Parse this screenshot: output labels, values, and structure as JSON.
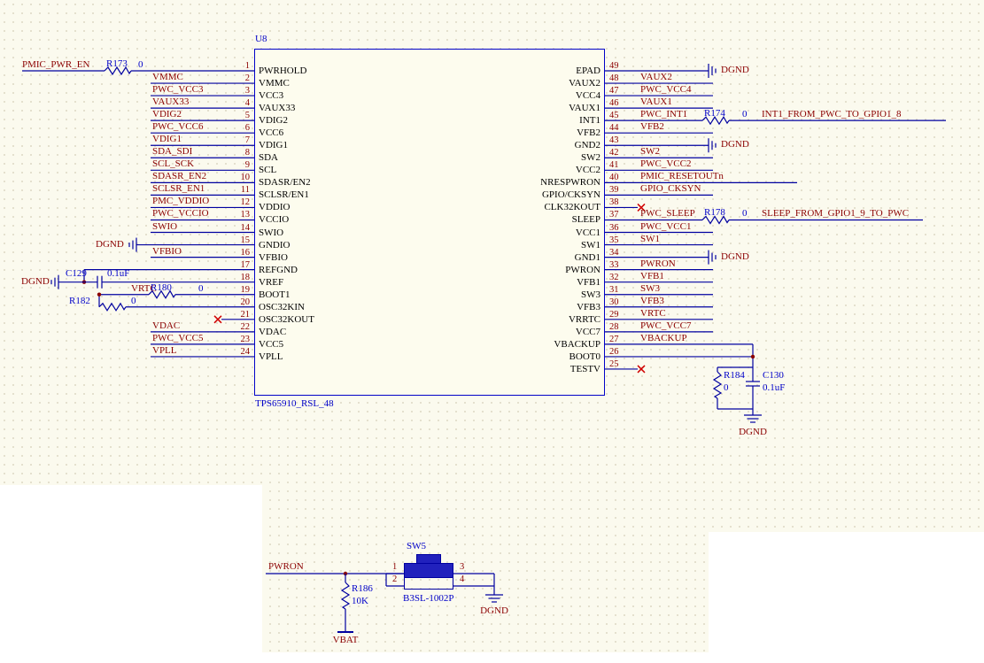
{
  "colors": {
    "wire": "#0000a0",
    "net_label": "#8b0000",
    "designator": "#0000c8",
    "pin_name": "#000000",
    "pin_number": "#8b0000",
    "no_connect": "#d00000",
    "switch_fill": "#2121bd"
  },
  "chip": {
    "designator": "U8",
    "comment": "TPS65910_RSL_48",
    "left_rows": [
      {
        "pin": "1",
        "pin_name": "PWRHOLD",
        "conn": "series",
        "net": "PMIC_PWR_EN",
        "ref": "R173",
        "value": "0"
      },
      {
        "pin": "2",
        "pin_name": "VMMC",
        "conn": "label",
        "net": "VMMC"
      },
      {
        "pin": "3",
        "pin_name": "VCC3",
        "conn": "label",
        "net": "PWC_VCC3"
      },
      {
        "pin": "4",
        "pin_name": "VAUX33",
        "conn": "label",
        "net": "VAUX33"
      },
      {
        "pin": "5",
        "pin_name": "VDIG2",
        "conn": "label",
        "net": "VDIG2"
      },
      {
        "pin": "6",
        "pin_name": "VCC6",
        "conn": "label",
        "net": "PWC_VCC6"
      },
      {
        "pin": "7",
        "pin_name": "VDIG1",
        "conn": "label",
        "net": "VDIG1"
      },
      {
        "pin": "8",
        "pin_name": "SDA",
        "conn": "label",
        "net": "SDA_SDI"
      },
      {
        "pin": "9",
        "pin_name": "SCL",
        "conn": "label",
        "net": "SCL_SCK"
      },
      {
        "pin": "10",
        "pin_name": "SDASR/EN2",
        "conn": "label",
        "net": "SDASR_EN2"
      },
      {
        "pin": "11",
        "pin_name": "SCLSR/EN1",
        "conn": "label",
        "net": "SCLSR_EN1"
      },
      {
        "pin": "12",
        "pin_name": "VDDIO",
        "conn": "label",
        "net": "PMC_VDDIO"
      },
      {
        "pin": "13",
        "pin_name": "VCCIO",
        "conn": "label",
        "net": "PWC_VCCIO"
      },
      {
        "pin": "14",
        "pin_name": "SWIO",
        "conn": "label",
        "net": "SWIO"
      },
      {
        "pin": "15",
        "pin_name": "GNDIO",
        "conn": "gnd",
        "net": "DGND"
      },
      {
        "pin": "16",
        "pin_name": "VFBIO",
        "conn": "label",
        "net": "VFBIO"
      },
      {
        "pin": "17",
        "pin_name": "REFGND",
        "conn": "custom"
      },
      {
        "pin": "18",
        "pin_name": "VREF",
        "conn": "custom",
        "net": "DGND",
        "ref": "C129",
        "value": "0.1uF"
      },
      {
        "pin": "19",
        "pin_name": "BOOT1",
        "conn": "custom",
        "net": "VRTC",
        "ref": "R180",
        "value": "0"
      },
      {
        "pin": "20",
        "pin_name": "OSC32KIN",
        "conn": "custom",
        "ref": "R182",
        "value": "0"
      },
      {
        "pin": "21",
        "pin_name": "OSC32KOUT",
        "conn": "nc"
      },
      {
        "pin": "22",
        "pin_name": "VDAC",
        "conn": "label",
        "net": "VDAC"
      },
      {
        "pin": "23",
        "pin_name": "VCC5",
        "conn": "label",
        "net": "PWC_VCC5"
      },
      {
        "pin": "24",
        "pin_name": "VPLL",
        "conn": "label",
        "net": "VPLL"
      }
    ],
    "right_rows": [
      {
        "pin": "49",
        "pin_name": "EPAD",
        "conn": "gnd",
        "net": "DGND"
      },
      {
        "pin": "48",
        "pin_name": "VAUX2",
        "conn": "label",
        "net": "VAUX2"
      },
      {
        "pin": "47",
        "pin_name": "VCC4",
        "conn": "label",
        "net": "PWC_VCC4"
      },
      {
        "pin": "46",
        "pin_name": "VAUX1",
        "conn": "label",
        "net": "VAUX1"
      },
      {
        "pin": "45",
        "pin_name": "INT1",
        "conn": "series2",
        "net": "PWC_INT1",
        "ref": "R174",
        "value": "0",
        "net2": "INT1_FROM_PWC_TO_GPIO1_8"
      },
      {
        "pin": "44",
        "pin_name": "VFB2",
        "conn": "label",
        "net": "VFB2"
      },
      {
        "pin": "43",
        "pin_name": "GND2",
        "conn": "gnd",
        "net": "DGND"
      },
      {
        "pin": "42",
        "pin_name": "SW2",
        "conn": "label",
        "net": "SW2"
      },
      {
        "pin": "41",
        "pin_name": "VCC2",
        "conn": "label",
        "net": "PWC_VCC2"
      },
      {
        "pin": "40",
        "pin_name": "NRESPWRON",
        "conn": "longlabel",
        "net": "PMIC_RESETOUTn"
      },
      {
        "pin": "39",
        "pin_name": "GPIO/CKSYN",
        "conn": "label",
        "net": "GPIO_CKSYN"
      },
      {
        "pin": "38",
        "pin_name": "CLK32KOUT",
        "conn": "nc"
      },
      {
        "pin": "37",
        "pin_name": "SLEEP",
        "conn": "series2",
        "net": "PWC_SLEEP",
        "ref": "R178",
        "value": "0",
        "net2": "SLEEP_FROM_GPIO1_9_TO_PWC"
      },
      {
        "pin": "36",
        "pin_name": "VCC1",
        "conn": "label",
        "net": "PWC_VCC1"
      },
      {
        "pin": "35",
        "pin_name": "SW1",
        "conn": "label",
        "net": "SW1"
      },
      {
        "pin": "34",
        "pin_name": "GND1",
        "conn": "gnd",
        "net": "DGND"
      },
      {
        "pin": "33",
        "pin_name": "PWRON",
        "conn": "label",
        "net": "PWRON"
      },
      {
        "pin": "32",
        "pin_name": "VFB1",
        "conn": "label",
        "net": "VFB1"
      },
      {
        "pin": "31",
        "pin_name": "SW3",
        "conn": "label",
        "net": "SW3"
      },
      {
        "pin": "30",
        "pin_name": "VFB3",
        "conn": "label",
        "net": "VFB3"
      },
      {
        "pin": "29",
        "pin_name": "VRRTC",
        "conn": "label",
        "net": "VRTC"
      },
      {
        "pin": "28",
        "pin_name": "VCC7",
        "conn": "label",
        "net": "PWC_VCC7"
      },
      {
        "pin": "27",
        "pin_name": "VBACKUP",
        "conn": "labelwire",
        "net": "VBACKUP"
      },
      {
        "pin": "26",
        "pin_name": "BOOT0",
        "conn": "wire"
      },
      {
        "pin": "25",
        "pin_name": "TESTV",
        "conn": "nc"
      }
    ]
  },
  "backup_rc": {
    "r_ref": "R184",
    "r_val": "0",
    "c_ref": "C130",
    "c_val": "0.1uF",
    "gnd": "DGND"
  },
  "switch_circuit": {
    "net": "PWRON",
    "r_ref": "R186",
    "r_val": "10K",
    "power": "VBAT",
    "sw_ref": "SW5",
    "sw_part": "B3SL-1002P",
    "pins": [
      "1",
      "2",
      "3",
      "4"
    ],
    "gnd": "DGND"
  }
}
